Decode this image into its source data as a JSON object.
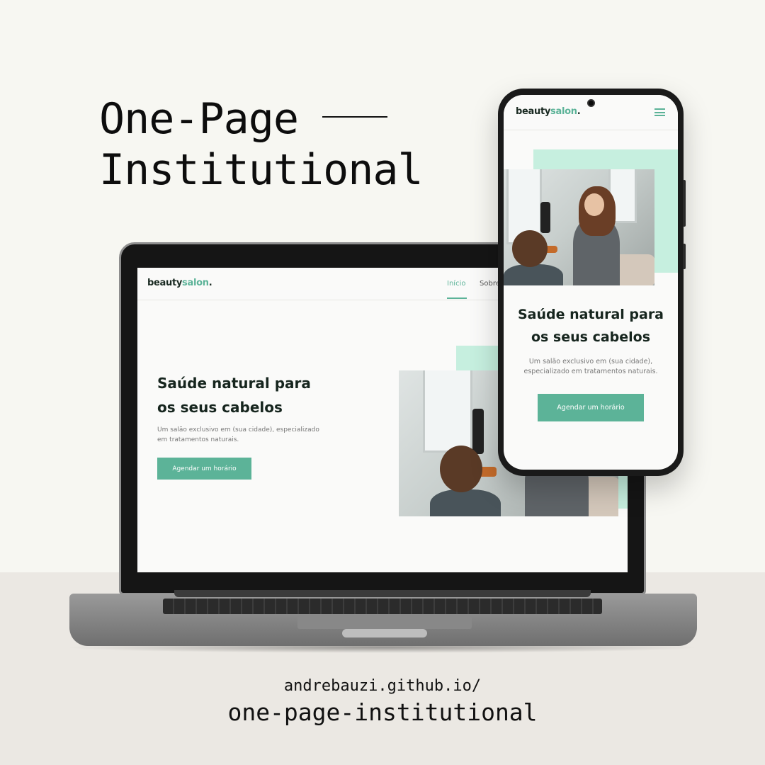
{
  "headline": {
    "line1": "One-Page",
    "line2": "Institutional"
  },
  "footer": {
    "url_line1": "andrebauzi.github.io/",
    "url_line2": "one-page-institutional"
  },
  "site": {
    "logo_part1": "beauty",
    "logo_part2": "salon",
    "logo_dot": ".",
    "nav": [
      {
        "label": "Início",
        "active": true
      },
      {
        "label": "Sobre",
        "active": false
      }
    ],
    "hero_title_line1": "Saúde natural para",
    "hero_title_line2": "os seus cabelos",
    "hero_sub_line1": "Um salão exclusivo em (sua cidade), especializado",
    "hero_sub_line2": "em tratamentos naturais.",
    "hero_sub_mobile_line1": "Um salão exclusivo em (sua cidade),",
    "hero_sub_mobile_line2": "especializado em tratamentos naturais.",
    "cta_label": "Agendar um horário"
  },
  "colors": {
    "accent": "#5cb398",
    "accent_light": "#c6efdf",
    "dark_text": "#16251e",
    "background": "#f7f7f2",
    "floor": "#ebe8e3"
  },
  "icons": {
    "menu": "hamburger-menu-icon",
    "camera": "front-camera-icon"
  }
}
